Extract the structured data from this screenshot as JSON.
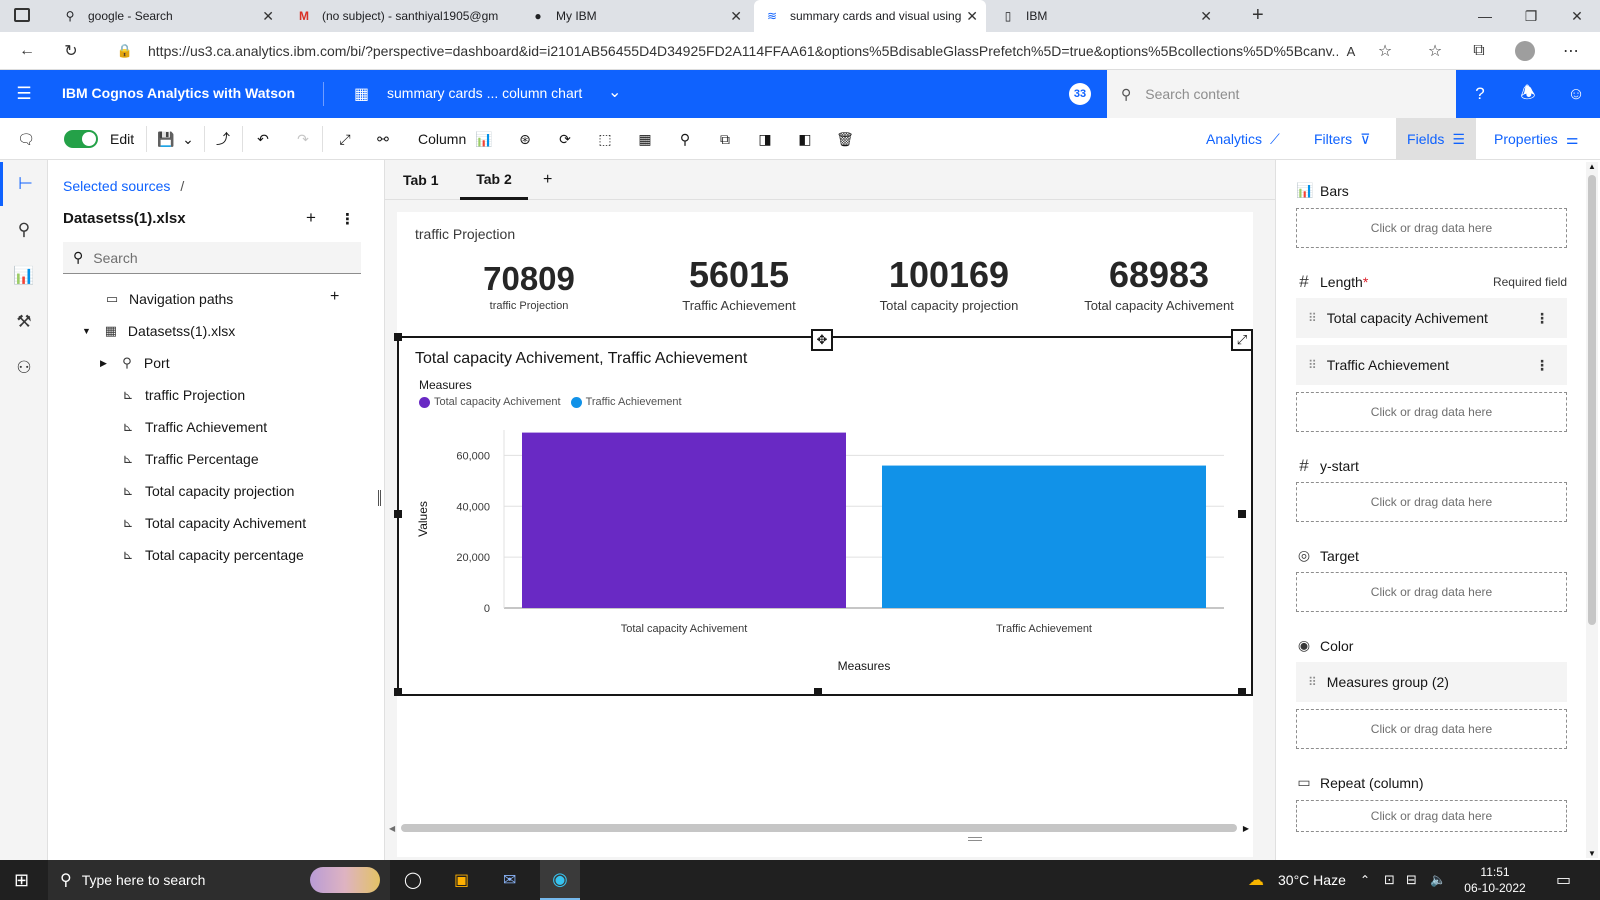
{
  "browser": {
    "tabs": [
      {
        "icon": "search-icon",
        "label": "google - Search",
        "active": false
      },
      {
        "icon": "gmail-icon",
        "label": "(no subject) - santhiyal1905@gm",
        "active": false
      },
      {
        "icon": "ibm-icon",
        "label": "My IBM",
        "active": false
      },
      {
        "icon": "cognos-icon",
        "label": "summary cards and visual using",
        "active": true
      },
      {
        "icon": "page-icon",
        "label": "IBM",
        "active": false
      }
    ],
    "url": "https://us3.ca.analytics.ibm.com/bi/?perspective=dashboard&id=i2101AB56455D4D34925FD2A114FFAA61&options%5BdisableGlassPrefetch%5D=true&options%5Bcollections%5D%5Bcanv..."
  },
  "app": {
    "title": "IBM Cognos Analytics with Watson",
    "doc_title": "summary cards ... column chart",
    "badge": "33",
    "search_placeholder": "Search content"
  },
  "toolbar": {
    "edit_label": "Edit",
    "viz_type_label": "Column",
    "analytics_label": "Analytics",
    "filters_label": "Filters",
    "fields_label": "Fields",
    "properties_label": "Properties"
  },
  "datapanel": {
    "breadcrumb": "Selected sources",
    "breadcrumb_sep": "/",
    "source_name": "Datasetss(1).xlsx",
    "search_placeholder": "Search",
    "tree": [
      {
        "label": "Navigation paths",
        "icon": "folder-icon"
      },
      {
        "label": "Datasetss(1).xlsx",
        "icon": "table-icon"
      },
      {
        "label": "Port",
        "icon": "location-icon"
      },
      {
        "label": "traffic Projection",
        "icon": "measure-icon"
      },
      {
        "label": "Traffic Achievement",
        "icon": "measure-icon"
      },
      {
        "label": "Traffic Percentage",
        "icon": "measure-icon"
      },
      {
        "label": "Total capacity projection",
        "icon": "measure-icon"
      },
      {
        "label": "Total capacity Achivement",
        "icon": "measure-icon"
      },
      {
        "label": "Total capacity percentage",
        "icon": "measure-icon"
      }
    ]
  },
  "canvas": {
    "tabs": [
      "Tab 1",
      "Tab 2"
    ],
    "active_tab": "Tab 2",
    "summary_title": "traffic Projection",
    "kpis": [
      {
        "value": "70809",
        "label": "traffic Projection"
      },
      {
        "value": "56015",
        "label": "Traffic Achievement"
      },
      {
        "value": "100169",
        "label": "Total capacity projection"
      },
      {
        "value": "68983",
        "label": "Total capacity Achivement"
      }
    ]
  },
  "chart_data": {
    "type": "bar",
    "title": "Total capacity Achivement, Traffic Achievement",
    "legend_title": "Measures",
    "legend_position": "top-left",
    "categories": [
      "Total capacity Achivement",
      "Traffic Achievement"
    ],
    "values": [
      68983,
      56015
    ],
    "colors": [
      "#6929c4",
      "#1192e8"
    ],
    "xlabel": "Measures",
    "ylabel": "Values",
    "ylim": [
      0,
      70000
    ],
    "yticks": [
      0,
      20000,
      40000,
      60000
    ],
    "ytick_labels": [
      "0",
      "20,000",
      "40,000",
      "60,000"
    ],
    "grid": true
  },
  "fields": {
    "bars_label": "Bars",
    "slot_placeholder": "Click or drag data here",
    "length_label": "Length",
    "required_mark": "*",
    "required_text": "Required field",
    "length_items": [
      "Total capacity Achivement",
      "Traffic Achievement"
    ],
    "ystart_label": "y-start",
    "target_label": "Target",
    "color_label": "Color",
    "color_item": "Measures group (2)",
    "repeat_label": "Repeat (column)"
  },
  "taskbar": {
    "search_placeholder": "Type here to search",
    "weather": "30°C  Haze",
    "time": "11:51",
    "date": "06-10-2022"
  }
}
